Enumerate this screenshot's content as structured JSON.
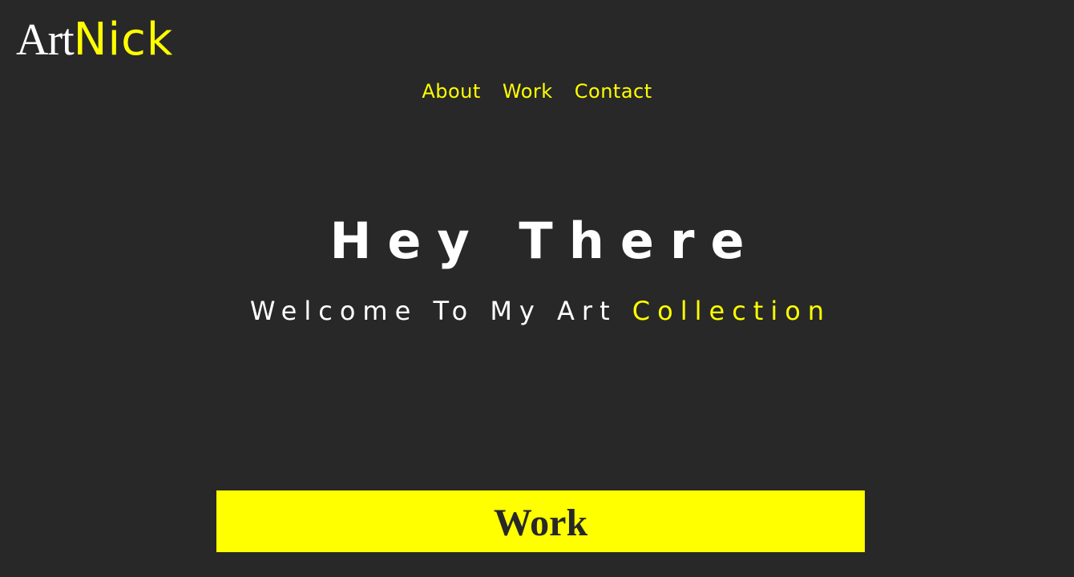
{
  "colors": {
    "background": "#282828",
    "accent": "#ffff00",
    "text": "#ffffff"
  },
  "logo": {
    "part1": "Art",
    "part2": "Nick"
  },
  "nav": {
    "items": [
      {
        "label": "About"
      },
      {
        "label": "Work"
      },
      {
        "label": "Contact"
      }
    ]
  },
  "hero": {
    "title": "Hey There",
    "subtitle_main": "Welcome To My Art",
    "subtitle_accent": "Collection"
  },
  "work_section": {
    "heading": "Work"
  }
}
